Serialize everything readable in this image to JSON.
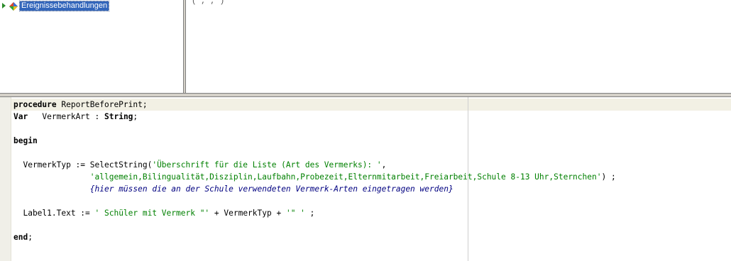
{
  "tree": {
    "selected_item": "Ereignissebehandlungen"
  },
  "props": {
    "partial_text": "(  ,  ,  )"
  },
  "editor": {
    "lines": [
      [
        {
          "t": "procedure",
          "c": "kw"
        },
        {
          "t": " ReportBeforePrint;",
          "c": ""
        }
      ],
      [
        {
          "t": "Var",
          "c": "kw"
        },
        {
          "t": "   VermerkArt : ",
          "c": ""
        },
        {
          "t": "String",
          "c": "kw"
        },
        {
          "t": ";",
          "c": ""
        }
      ],
      [],
      [
        {
          "t": "begin",
          "c": "kw"
        }
      ],
      [],
      [
        {
          "t": "  VermerkTyp := SelectString(",
          "c": ""
        },
        {
          "t": "'Überschrift für die Liste (Art des Vermerks): '",
          "c": "str"
        },
        {
          "t": ",",
          "c": ""
        }
      ],
      [
        {
          "t": "                ",
          "c": ""
        },
        {
          "t": "'allgemein,Bilingualität,Disziplin,Laufbahn,Probezeit,Elternmitarbeit,Freiarbeit,Schule 8-13 Uhr,Sternchen'",
          "c": "str"
        },
        {
          "t": ") ;",
          "c": ""
        }
      ],
      [
        {
          "t": "                ",
          "c": ""
        },
        {
          "t": "{hier müssen die an der Schule verwendeten Vermerk-Arten eingetragen werden}",
          "c": "cmt"
        }
      ],
      [],
      [
        {
          "t": "  Label1.Text := ",
          "c": ""
        },
        {
          "t": "' Schüler mit Vermerk \"'",
          "c": "str"
        },
        {
          "t": " + VermerkTyp + ",
          "c": ""
        },
        {
          "t": "'\" '",
          "c": "str"
        },
        {
          "t": " ;",
          "c": ""
        }
      ],
      [],
      [
        {
          "t": "end",
          "c": "kw"
        },
        {
          "t": ";",
          "c": ""
        }
      ]
    ]
  }
}
